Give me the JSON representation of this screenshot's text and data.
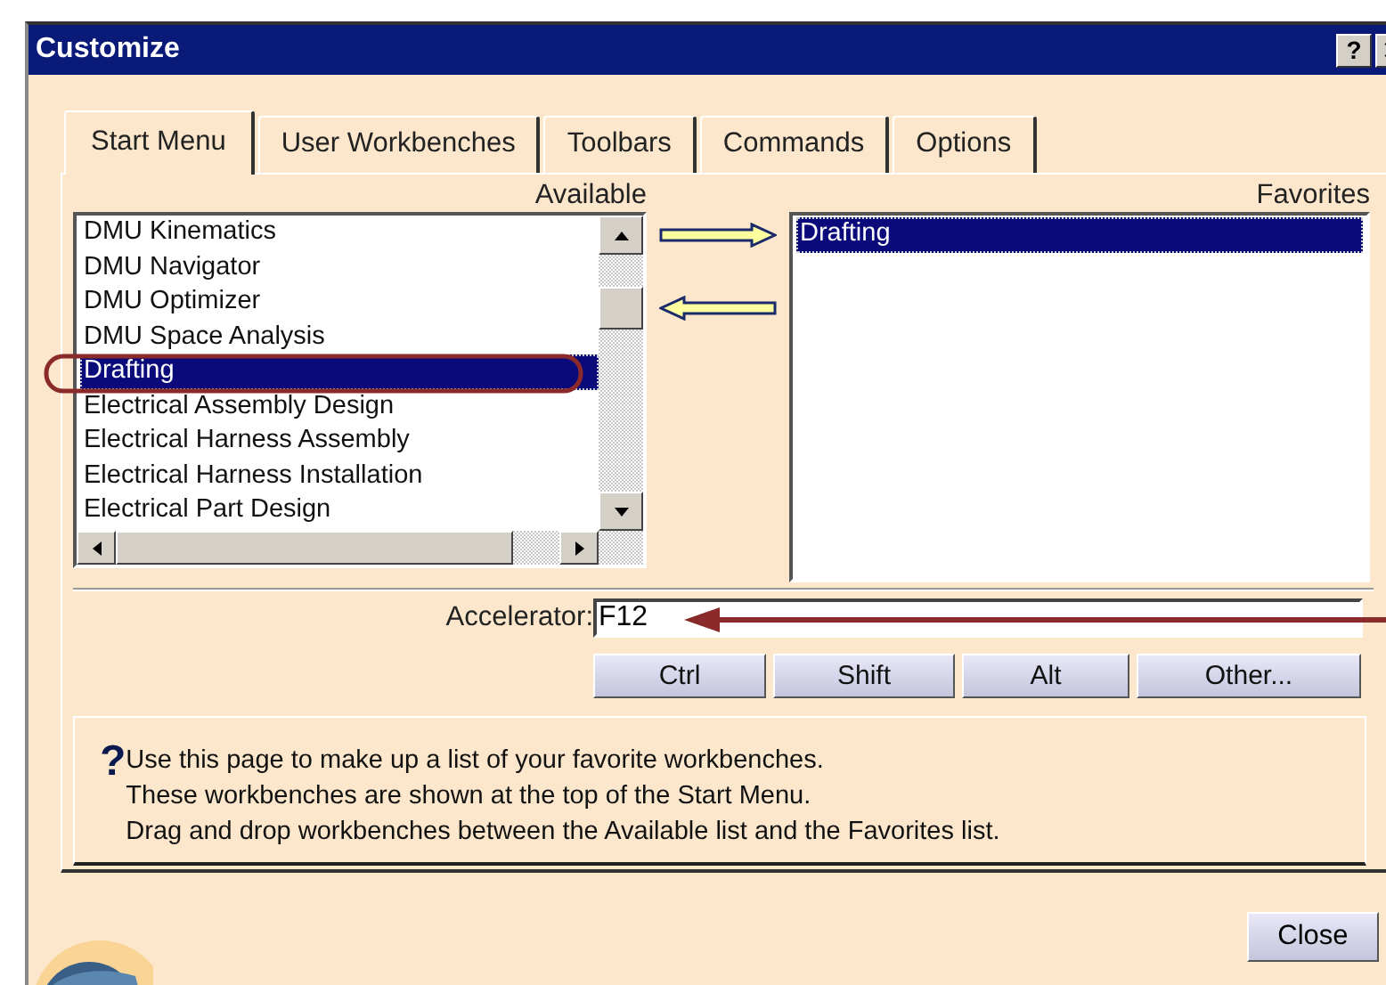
{
  "window": {
    "title": "Customize",
    "help_button": "?"
  },
  "tabs": [
    {
      "label": "Start Menu",
      "selected": true
    },
    {
      "label": "User Workbenches",
      "selected": false
    },
    {
      "label": "Toolbars",
      "selected": false
    },
    {
      "label": "Commands",
      "selected": false
    },
    {
      "label": "Options",
      "selected": false
    }
  ],
  "available": {
    "label": "Available",
    "items": [
      {
        "label": "DMU Kinematics",
        "selected": false
      },
      {
        "label": "DMU Navigator",
        "selected": false
      },
      {
        "label": "DMU Optimizer",
        "selected": false
      },
      {
        "label": "DMU Space Analysis",
        "selected": false
      },
      {
        "label": "Drafting",
        "selected": true
      },
      {
        "label": "Electrical Assembly Design",
        "selected": false
      },
      {
        "label": "Electrical Harness Assembly",
        "selected": false
      },
      {
        "label": "Electrical Harness Installation",
        "selected": false
      },
      {
        "label": "Electrical Part Design",
        "selected": false
      }
    ]
  },
  "favorites": {
    "label": "Favorites",
    "items": [
      {
        "label": "Drafting",
        "selected": true
      }
    ]
  },
  "accelerator": {
    "label": "Accelerator:",
    "value": "F12"
  },
  "modifier_buttons": [
    "Ctrl",
    "Shift",
    "Alt",
    "Other..."
  ],
  "help": {
    "icon": "?",
    "lines": [
      "Use this page to make up a list of your favorite workbenches.",
      "These workbenches are shown at the top of the Start Menu.",
      "Drag and drop workbenches between the Available list and the Favorites list."
    ]
  },
  "close_button": "Close",
  "annotations": [
    {
      "kind": "ellipse"
    },
    {
      "kind": "arrow"
    }
  ]
}
